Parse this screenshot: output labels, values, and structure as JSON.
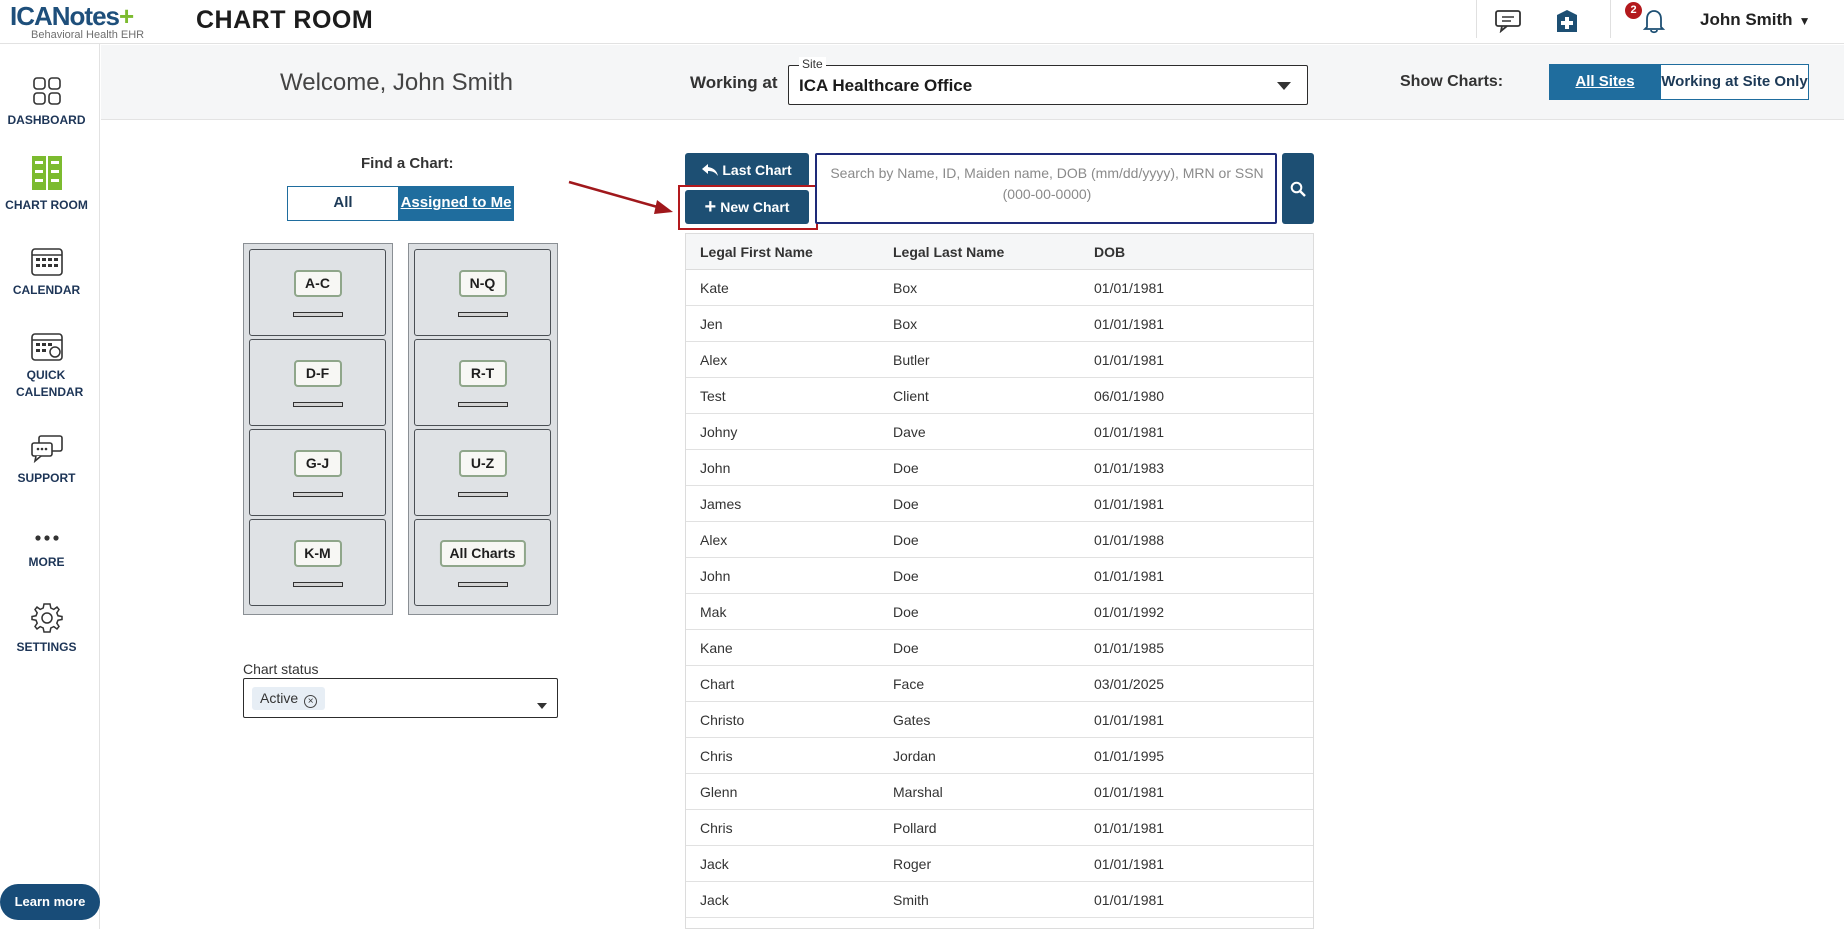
{
  "app": {
    "logo_main": "ICANotes",
    "logo_plus": "+",
    "logo_sub": "Behavioral Health EHR",
    "page_title": "CHART ROOM"
  },
  "topbar": {
    "notification_count": "2",
    "user_name": "John Smith",
    "icons": [
      "chat-icon",
      "pharmacy-icon",
      "bell-icon"
    ]
  },
  "sidebar": {
    "items": [
      {
        "label": "DASHBOARD",
        "icon": "dashboard-icon"
      },
      {
        "label": "CHART ROOM",
        "icon": "file-cabinet-icon"
      },
      {
        "label": "CALENDAR",
        "icon": "calendar-icon"
      },
      {
        "label": "QUICK CALENDAR",
        "icon": "quick-calendar-icon"
      },
      {
        "label": "SUPPORT",
        "icon": "support-icon"
      },
      {
        "label": "MORE",
        "icon": "more-icon"
      },
      {
        "label": "SETTINGS",
        "icon": "gear-icon"
      }
    ],
    "learn_more": "Learn more"
  },
  "header": {
    "welcome": "Welcome, John Smith",
    "working_at_label": "Working at",
    "site_legend": "Site",
    "site_value": "ICA Healthcare Office",
    "show_charts_label": "Show Charts:",
    "show_charts_options": [
      "All Sites",
      "Working at Site Only"
    ],
    "show_charts_selected": "All Sites"
  },
  "finder": {
    "label": "Find a Chart:",
    "options": [
      "All",
      "Assigned to Me"
    ],
    "selected": "Assigned to Me",
    "cabinet_left": [
      "A-C",
      "D-F",
      "G-J",
      "K-M"
    ],
    "cabinet_right": [
      "N-Q",
      "R-T",
      "U-Z",
      "All Charts"
    ],
    "status_label": "Chart status",
    "status_chip": "Active"
  },
  "actions": {
    "last_chart": "Last Chart",
    "new_chart": "New Chart",
    "search_placeholder": "Search by Name, ID, Maiden name, DOB (mm/dd/yyyy), MRN or SSN (000-00-0000)"
  },
  "table": {
    "columns": [
      "Legal First Name",
      "Legal Last Name",
      "DOB"
    ],
    "rows": [
      [
        "Kate",
        "Box",
        "01/01/1981"
      ],
      [
        "Jen",
        "Box",
        "01/01/1981"
      ],
      [
        "Alex",
        "Butler",
        "01/01/1981"
      ],
      [
        "Test",
        "Client",
        "06/01/1980"
      ],
      [
        "Johny",
        "Dave",
        "01/01/1981"
      ],
      [
        "John",
        "Doe",
        "01/01/1983"
      ],
      [
        "James",
        "Doe",
        "01/01/1981"
      ],
      [
        "Alex",
        "Doe",
        "01/01/1988"
      ],
      [
        "John",
        "Doe",
        "01/01/1981"
      ],
      [
        "Mak",
        "Doe",
        "01/01/1992"
      ],
      [
        "Kane",
        "Doe",
        "01/01/1985"
      ],
      [
        "Chart",
        "Face",
        "03/01/2025"
      ],
      [
        "Christo",
        "Gates",
        "01/01/1981"
      ],
      [
        "Chris",
        "Jordan",
        "01/01/1995"
      ],
      [
        "Glenn",
        "Marshal",
        "01/01/1981"
      ],
      [
        "Chris",
        "Pollard",
        "01/01/1981"
      ],
      [
        "Jack",
        "Roger",
        "01/01/1981"
      ],
      [
        "Jack",
        "Smith",
        "01/01/1981"
      ]
    ]
  },
  "colors": {
    "primary": "#1f6d9e",
    "dark_button": "#1d4f73",
    "highlight": "#b3191d",
    "logo_blue": "#1e4f7b",
    "logo_green": "#7cbb2f"
  }
}
